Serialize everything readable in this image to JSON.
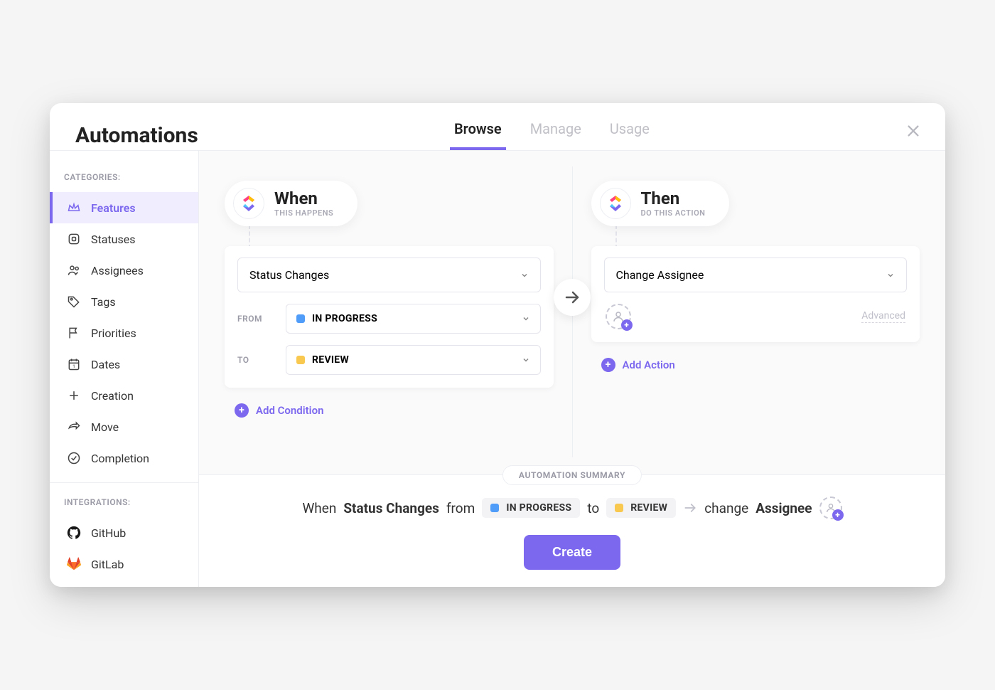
{
  "header": {
    "title": "Automations",
    "tabs": [
      {
        "label": "Browse",
        "active": true
      },
      {
        "label": "Manage",
        "active": false
      },
      {
        "label": "Usage",
        "active": false
      }
    ]
  },
  "sidebar": {
    "categories_label": "CATEGORIES:",
    "integrations_label": "INTEGRATIONS:",
    "categories": [
      {
        "label": "Features",
        "icon": "crown",
        "active": true
      },
      {
        "label": "Statuses",
        "icon": "square",
        "active": false
      },
      {
        "label": "Assignees",
        "icon": "users",
        "active": false
      },
      {
        "label": "Tags",
        "icon": "tag",
        "active": false
      },
      {
        "label": "Priorities",
        "icon": "flag",
        "active": false
      },
      {
        "label": "Dates",
        "icon": "calendar",
        "active": false
      },
      {
        "label": "Creation",
        "icon": "plus-square",
        "active": false
      },
      {
        "label": "Move",
        "icon": "share",
        "active": false
      },
      {
        "label": "Completion",
        "icon": "check-circle",
        "active": false
      }
    ],
    "integrations": [
      {
        "label": "GitHub",
        "icon": "github"
      },
      {
        "label": "GitLab",
        "icon": "gitlab"
      }
    ]
  },
  "builder": {
    "when": {
      "title": "When",
      "subtitle": "THIS HAPPENS",
      "trigger": "Status Changes",
      "from_label": "FROM",
      "from_status": "IN PROGRESS",
      "from_color": "#4f9cf9",
      "to_label": "TO",
      "to_status": "REVIEW",
      "to_color": "#f9c84f",
      "add_condition": "Add Condition"
    },
    "then": {
      "title": "Then",
      "subtitle": "DO THIS ACTION",
      "action": "Change Assignee",
      "advanced": "Advanced",
      "add_action": "Add Action"
    }
  },
  "summary": {
    "label": "AUTOMATION SUMMARY",
    "when_word": "When",
    "trigger": "Status Changes",
    "from_word": "from",
    "from_status": "IN PROGRESS",
    "to_word": "to",
    "to_status": "REVIEW",
    "change_word": "change",
    "target": "Assignee",
    "create_button": "Create"
  }
}
